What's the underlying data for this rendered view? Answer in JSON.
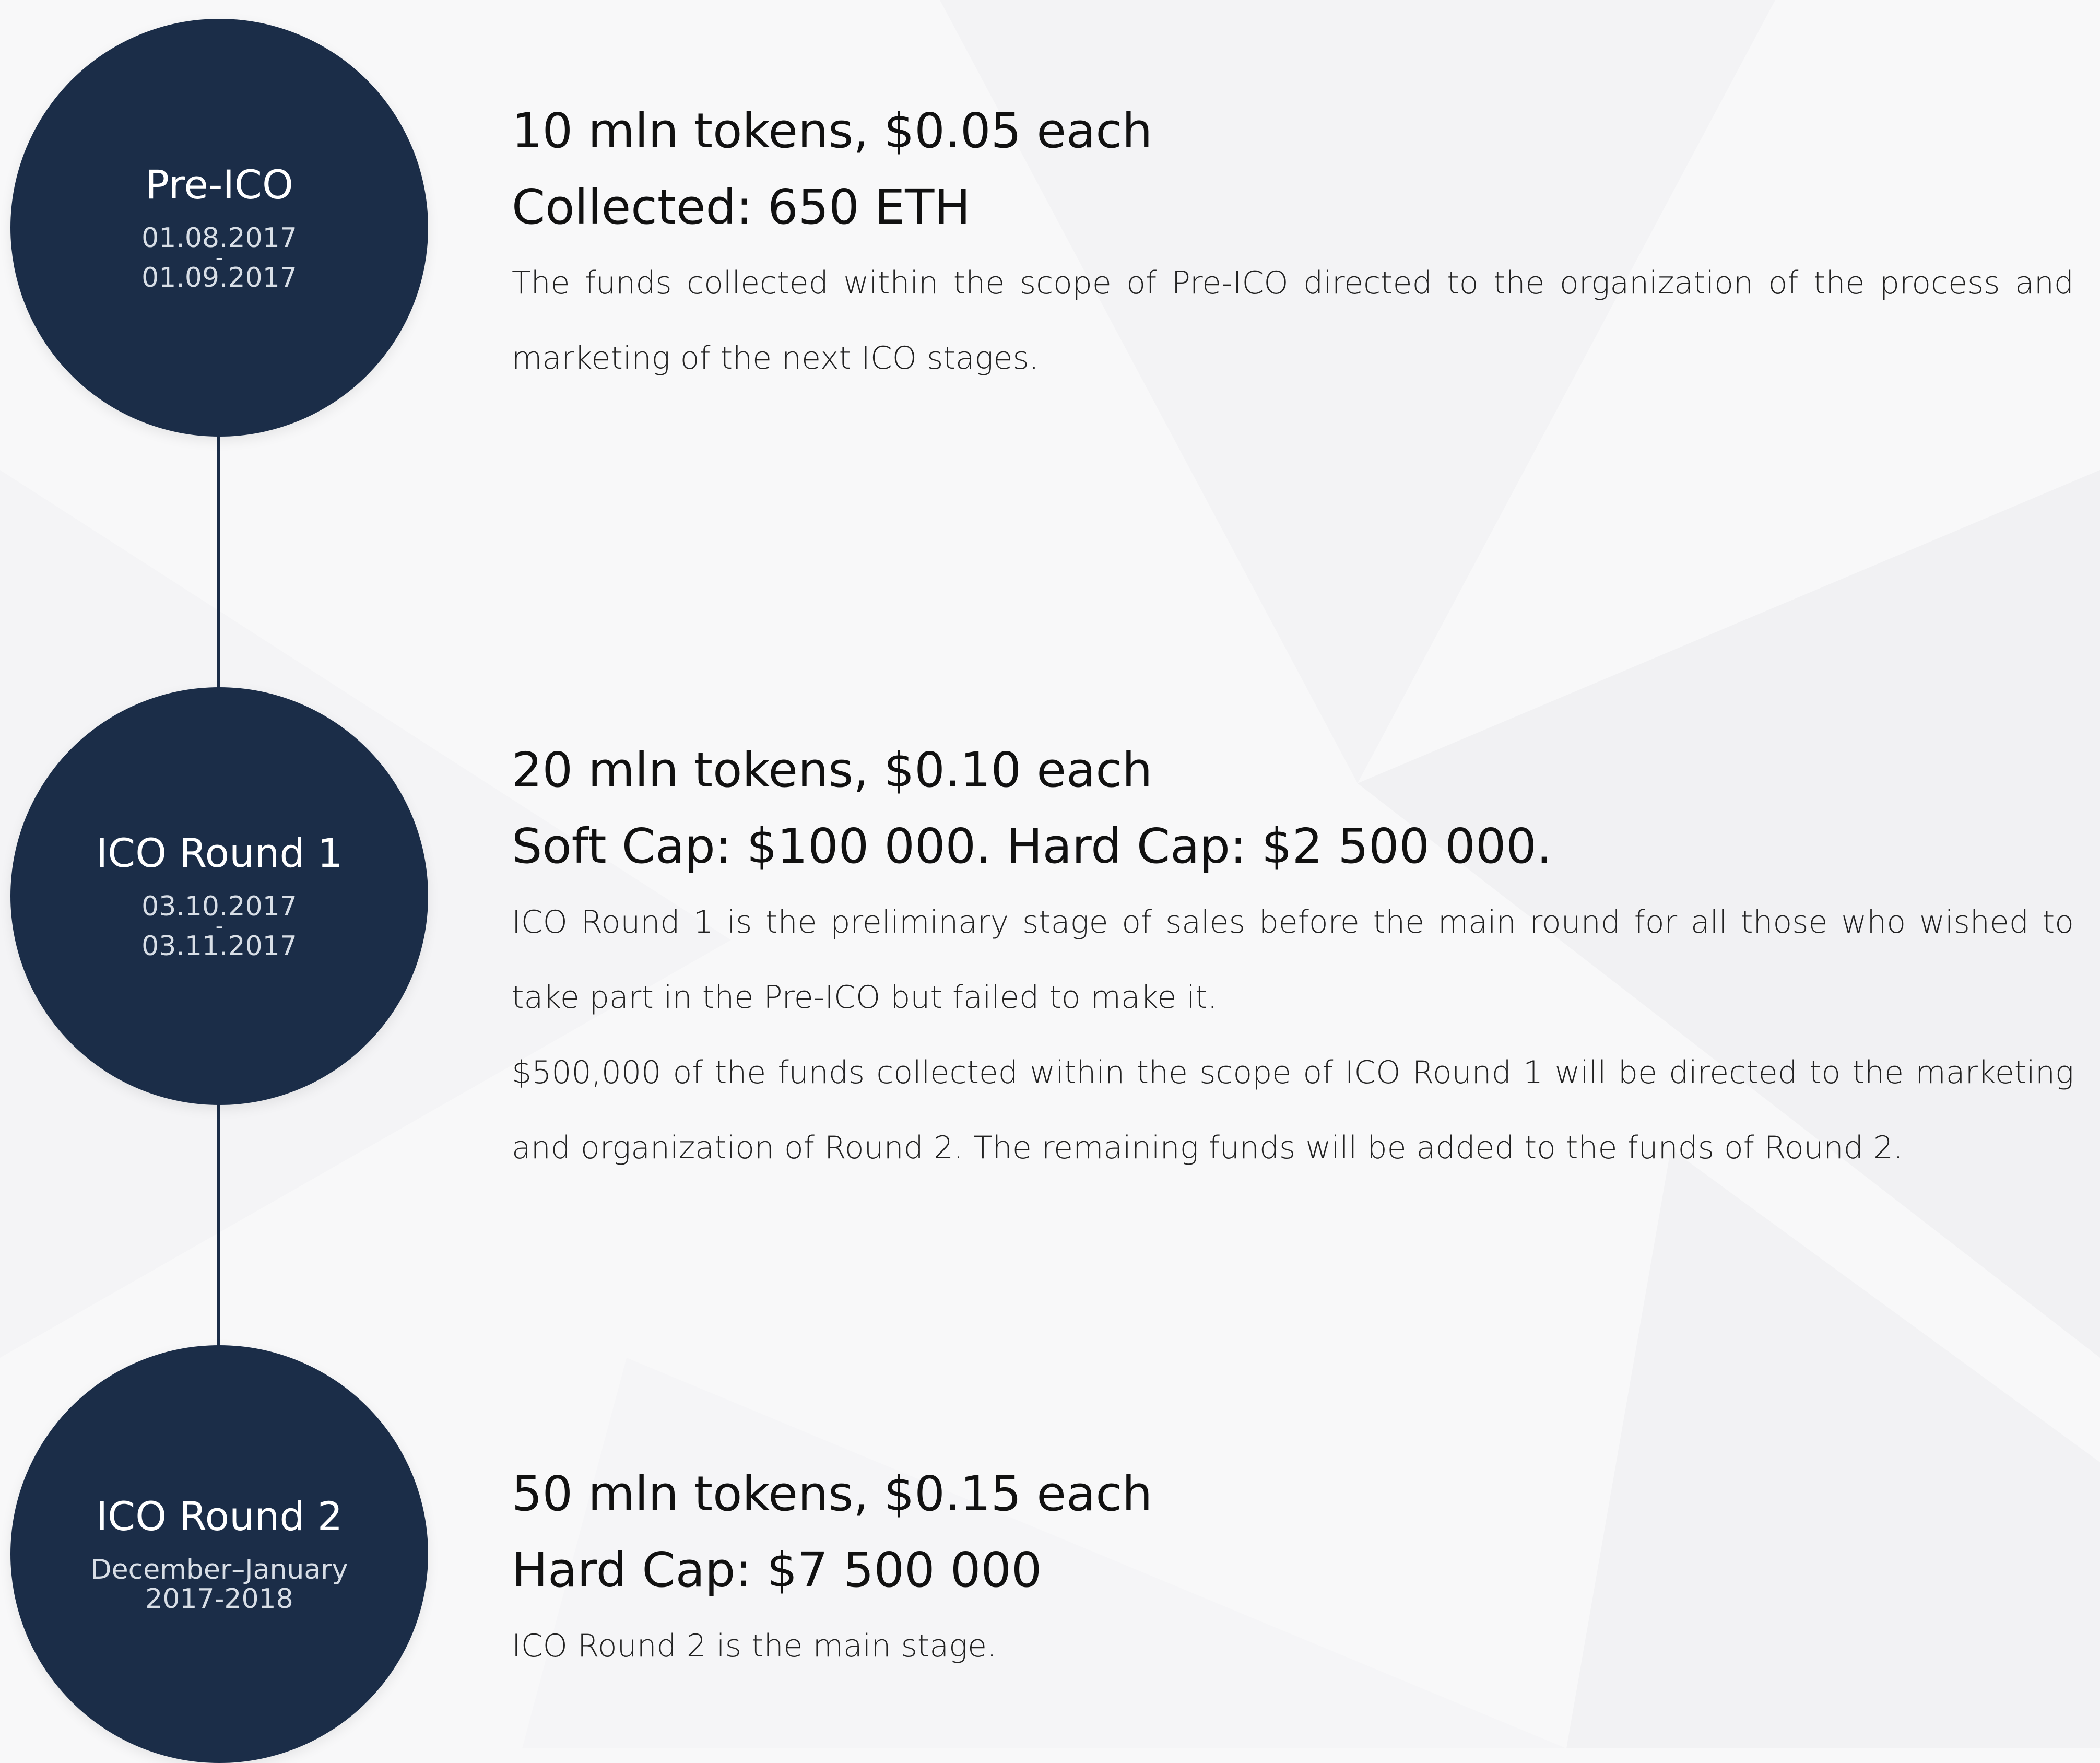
{
  "stages": [
    {
      "title": "Pre-ICO",
      "date_start": "01.08.2017",
      "date_sep": "-",
      "date_end": "01.09.2017",
      "headline1": "10 mln tokens, $0.05 each",
      "headline2": "Collected: 650 ETH",
      "paragraphs": [
        "The funds collected within the scope of Pre-ICO directed to the organization of the process and marketing of the next ICO stages."
      ]
    },
    {
      "title": "ICO Round 1",
      "date_start": "03.10.2017",
      "date_sep": "-",
      "date_end": "03.11.2017",
      "headline1": "20 mln tokens, $0.10 each",
      "headline2": "Soft Cap: $100 000. Hard Cap: $2 500 000.",
      "paragraphs": [
        "ICO Round 1 is the preliminary stage of sales before the main round for all those who wished to take part in the Pre-ICO but failed to make it.",
        "$500,000 of the funds collected within the scope of ICO Round 1 will be directed to the marketing and organization of Round 2. The remaining funds will be added to the funds of Round 2."
      ]
    },
    {
      "title": "ICO Round 2",
      "date_start": "December–January",
      "date_end": "2017-2018",
      "headline1": "50 mln tokens, $0.15 each",
      "headline2": "Hard Cap: $7 500 000",
      "paragraphs": [
        "ICO Round 2 is the main stage."
      ]
    }
  ],
  "colors": {
    "circle": "#1b2d48",
    "background": "#f8f8f9",
    "text": "#111111"
  }
}
